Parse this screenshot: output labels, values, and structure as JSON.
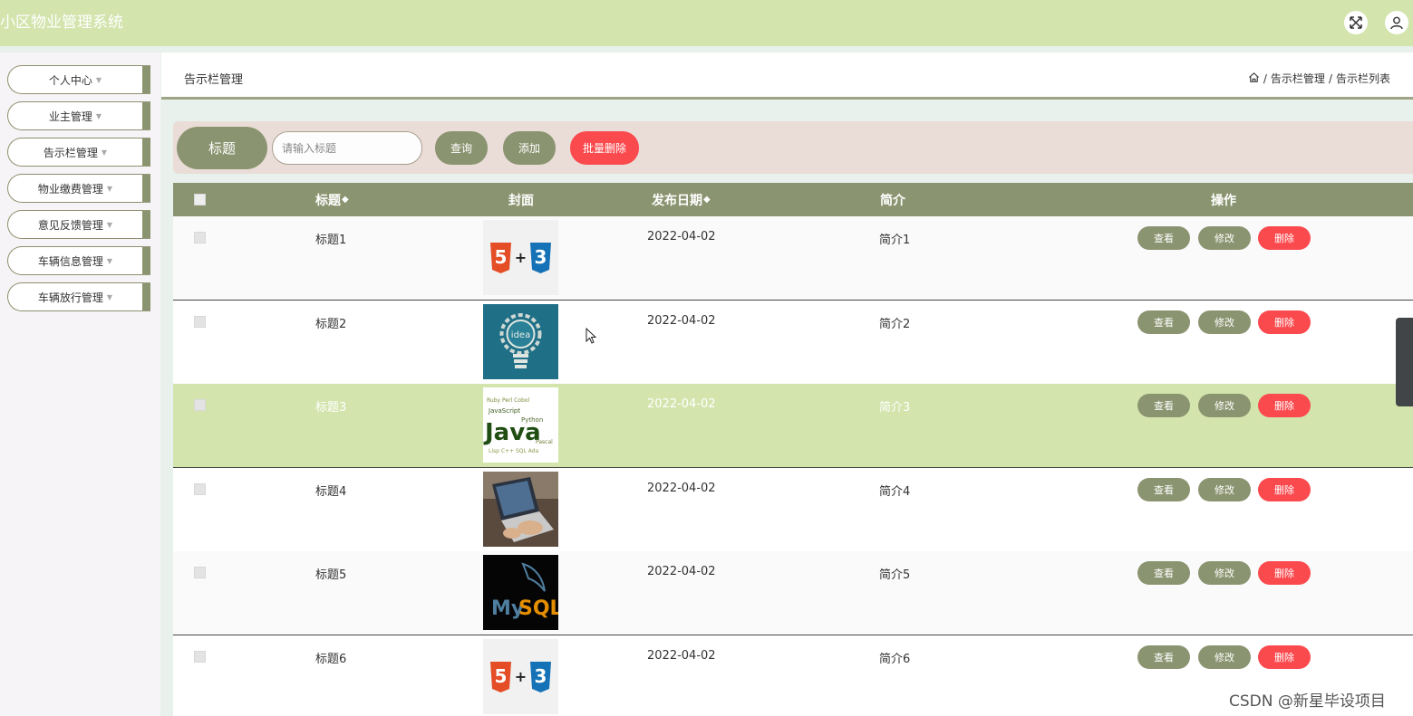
{
  "app": {
    "title": "小区物业管理系统"
  },
  "top_icons": [
    "fullscreen-icon",
    "user-icon"
  ],
  "sidebar": {
    "items": [
      {
        "label": "个人中心"
      },
      {
        "label": "业主管理"
      },
      {
        "label": "告示栏管理"
      },
      {
        "label": "物业缴费管理"
      },
      {
        "label": "意见反馈管理"
      },
      {
        "label": "车辆信息管理"
      },
      {
        "label": "车辆放行管理"
      }
    ]
  },
  "header": {
    "title": "告示栏管理",
    "breadcrumb": [
      "告示栏管理",
      "告示栏列表"
    ],
    "separator": "/"
  },
  "search": {
    "label": "标题",
    "placeholder": "请输入标题",
    "query_button": "查询",
    "add_button": "添加",
    "batch_delete_button": "批量删除"
  },
  "table": {
    "columns": [
      "标题",
      "封面",
      "发布日期",
      "简介",
      "操作"
    ],
    "sort_glyph": "◆",
    "rows": [
      {
        "title": "标题1",
        "date": "2022-04-02",
        "intro": "简介1",
        "cover": "html5-css3"
      },
      {
        "title": "标题2",
        "date": "2022-04-02",
        "intro": "简介2",
        "cover": "idea-bulb"
      },
      {
        "title": "标题3",
        "date": "2022-04-02",
        "intro": "简介3",
        "cover": "java-wordcloud"
      },
      {
        "title": "标题4",
        "date": "2022-04-02",
        "intro": "简介4",
        "cover": "laptop"
      },
      {
        "title": "标题5",
        "date": "2022-04-02",
        "intro": "简介5",
        "cover": "mysql"
      },
      {
        "title": "标题6",
        "date": "2022-04-02",
        "intro": "简介6",
        "cover": "html5-css3"
      }
    ],
    "actions": {
      "view": "查看",
      "edit": "修改",
      "delete": "删除"
    }
  },
  "watermark": "CSDN @新星毕设项目",
  "colors": {
    "topbar": "#d3e4ad",
    "olive": "#8b9470",
    "danger": "#fb4a4e",
    "highlight_row": "#d3e4ad",
    "search_bg": "#eaddd8"
  }
}
